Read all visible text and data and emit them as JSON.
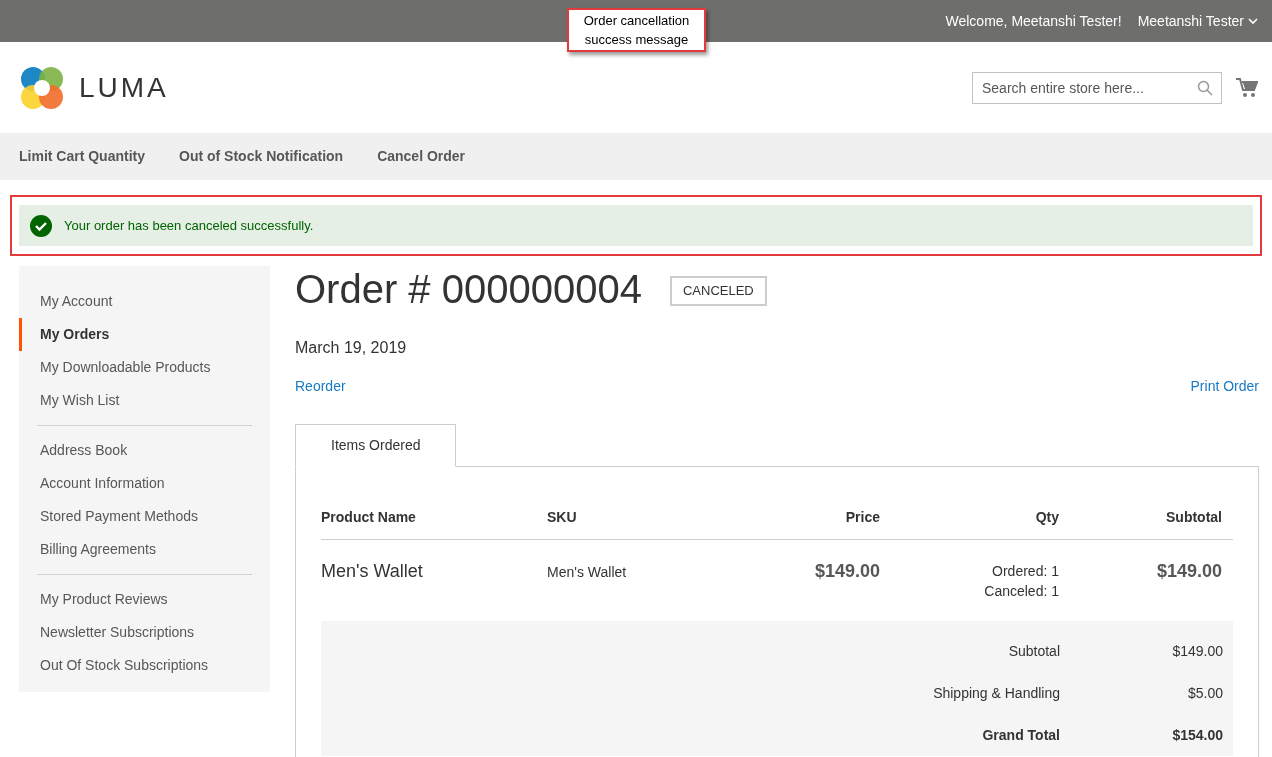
{
  "annotation": {
    "text": "Order cancellation success message"
  },
  "top_bar": {
    "welcome": "Welcome, Meetanshi Tester!",
    "account": "Meetanshi Tester"
  },
  "header": {
    "logo_text": "LUMA",
    "search": {
      "placeholder": "Search entire store here..."
    }
  },
  "nav": {
    "items": [
      "Limit Cart Quantity",
      "Out of Stock Notification",
      "Cancel Order"
    ]
  },
  "message": {
    "text": "Your order has been canceled successfully."
  },
  "sidebar": {
    "groups": [
      {
        "items": [
          {
            "label": "My Account",
            "selected": false
          },
          {
            "label": "My Orders",
            "selected": true
          },
          {
            "label": "My Downloadable Products",
            "selected": false
          },
          {
            "label": "My Wish List",
            "selected": false
          }
        ]
      },
      {
        "items": [
          {
            "label": "Address Book",
            "selected": false
          },
          {
            "label": "Account Information",
            "selected": false
          },
          {
            "label": "Stored Payment Methods",
            "selected": false
          },
          {
            "label": "Billing Agreements",
            "selected": false
          }
        ]
      },
      {
        "items": [
          {
            "label": "My Product Reviews",
            "selected": false
          },
          {
            "label": "Newsletter Subscriptions",
            "selected": false
          },
          {
            "label": "Out Of Stock Subscriptions",
            "selected": false
          }
        ]
      }
    ]
  },
  "order": {
    "title": "Order # 000000004",
    "status": "CANCELED",
    "date": "March 19, 2019",
    "links": [
      "Reorder",
      "Print Order"
    ],
    "tabs": [
      {
        "label": "Items Ordered",
        "selected": true
      }
    ],
    "table": {
      "columns": [
        "Product Name",
        "SKU",
        "Price",
        "Qty",
        "Subtotal"
      ],
      "rows": [
        {
          "name": "Men's Wallet",
          "sku": "Men's Wallet",
          "price": "$149.00",
          "qty": [
            "Ordered: 1",
            "Canceled: 1"
          ],
          "subtotal": "$149.00"
        }
      ],
      "totals": [
        {
          "label": "Subtotal",
          "value": "$149.00",
          "bold": false
        },
        {
          "label": "Shipping & Handling",
          "value": "$5.00",
          "bold": false
        },
        {
          "label": "Grand Total",
          "value": "$154.00",
          "bold": true
        }
      ]
    }
  }
}
